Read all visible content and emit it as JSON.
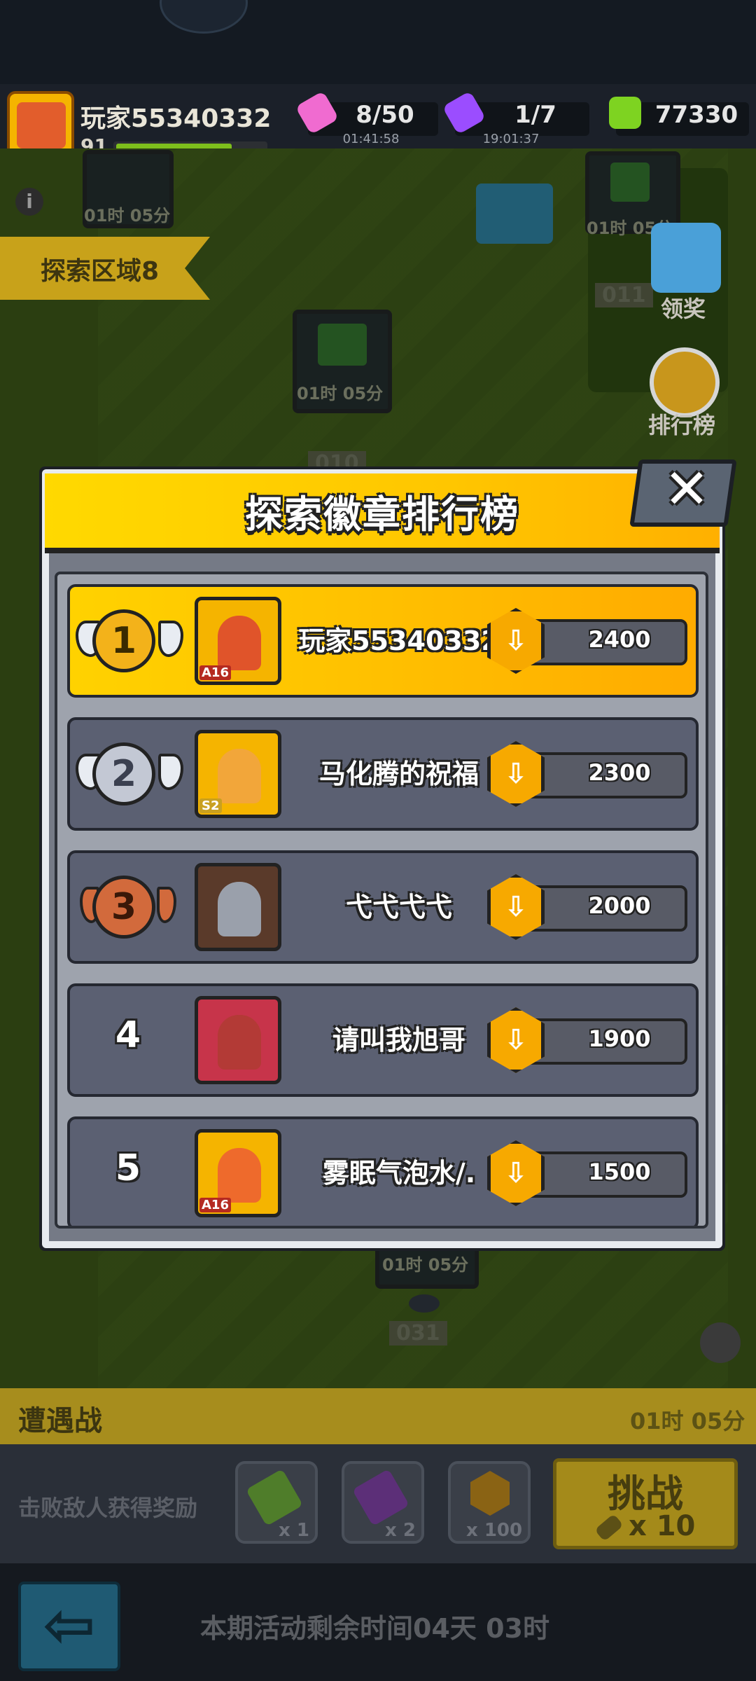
{
  "hud": {
    "player_name": "玩家55340332",
    "avatar_tag": "A16",
    "level": "91",
    "xp_fraction": 0.78,
    "resources": [
      {
        "icon": "pink-energy-icon",
        "value": "8/50",
        "timer": "01:41:58",
        "color": "#f06bd0"
      },
      {
        "icon": "purple-potion-icon",
        "value": "1/7",
        "timer": "19:01:37",
        "color": "#9b4dff"
      },
      {
        "icon": "green-gem-icon",
        "value": "77330",
        "timer": "",
        "color": "#7ed321"
      }
    ]
  },
  "map": {
    "area_banner": "探索区域8",
    "nodes": [
      {
        "timer": "01时 05分"
      },
      {
        "timer": "01时 05分",
        "number": "011"
      },
      {
        "timer": "01时 05分",
        "number": "010"
      },
      {
        "timer": "01时 05分",
        "number": "031"
      }
    ],
    "side_buttons": {
      "gift_label": "领奖",
      "leaderboard_label": "排行榜"
    }
  },
  "modal": {
    "title": "探索徽章排行榜",
    "close_glyph": "✕",
    "rows": [
      {
        "rank": "1",
        "name": "玩家55340332",
        "score": "2400",
        "tag": "A16",
        "avatar_color": "#e0542a",
        "badge_color": "#f3b21a"
      },
      {
        "rank": "2",
        "name": "马化腾的祝福",
        "score": "2300",
        "tag": "S2",
        "avatar_color": "#f2a63a",
        "badge_color": "#c3c8d4"
      },
      {
        "rank": "3",
        "name": "弋弋弋弋",
        "score": "2000",
        "tag": "",
        "avatar_color": "#9aa0ab",
        "badge_color": "#d26a3c"
      },
      {
        "rank": "4",
        "name": "请叫我旭哥",
        "score": "1900",
        "tag": "",
        "avatar_color": "#b33a36",
        "badge_color": ""
      },
      {
        "rank": "5",
        "name": "雾眠气泡水/.",
        "score": "1500",
        "tag": "A16",
        "avatar_color": "#ee6a2c",
        "badge_color": ""
      }
    ]
  },
  "encounter": {
    "title": "遭遇战",
    "time": "01时 05分",
    "reward_text": "击败敌人获得奖励",
    "rewards": [
      {
        "icon": "green-key-icon",
        "count": "x 1"
      },
      {
        "icon": "purple-key-icon",
        "count": "x 2"
      },
      {
        "icon": "badge-icon",
        "count": "x 100"
      }
    ],
    "challenge_label": "挑战",
    "challenge_cost": "x 10"
  },
  "footer": {
    "back_glyph": "⇦",
    "event_remaining": "本期活动剩余时间04天 03时"
  }
}
